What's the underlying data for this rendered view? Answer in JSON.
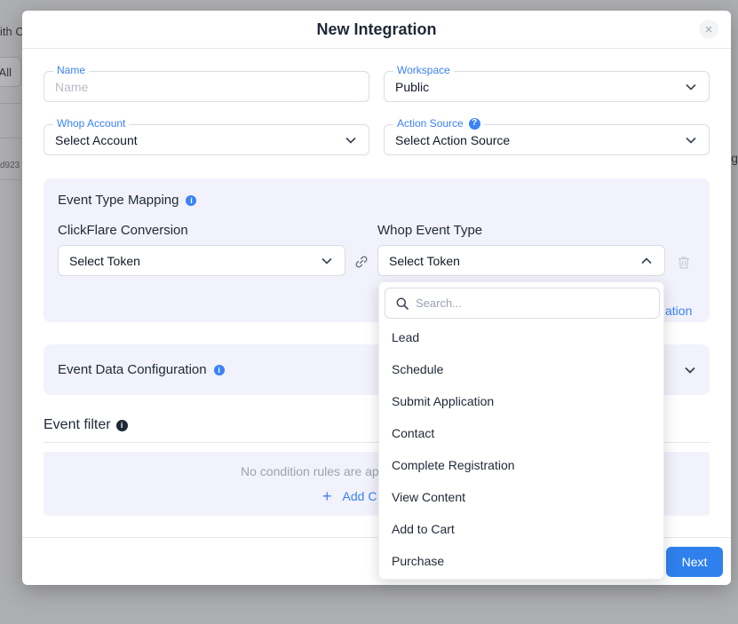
{
  "background": {
    "left_partial_text": "ith C",
    "all_button": "All",
    "partial_id": "d923",
    "right_partial_text": "g"
  },
  "modal": {
    "title": "New Integration",
    "close_glyph": "×"
  },
  "form": {
    "name": {
      "label": "Name",
      "placeholder": "Name",
      "value": ""
    },
    "workspace": {
      "label": "Workspace",
      "value": "Public"
    },
    "whop_account": {
      "label": "Whop Account",
      "value": "Select Account"
    },
    "action_source": {
      "label": "Action Source",
      "value": "Select Action Source"
    }
  },
  "event_mapping": {
    "title": "Event Type Mapping",
    "col_left": "ClickFlare Conversion",
    "col_right": "Whop Event Type",
    "left_select": "Select Token",
    "right_select": "Select Token",
    "partial_link": "ation"
  },
  "event_data": {
    "title": "Event Data Configuration"
  },
  "event_filter": {
    "title": "Event filter",
    "empty_text": "No condition rules are ap",
    "add_label": "Add C"
  },
  "footer": {
    "next_label": "Next"
  },
  "dropdown": {
    "search_placeholder": "Search...",
    "options": [
      "Lead",
      "Schedule",
      "Submit Application",
      "Contact",
      "Complete Registration",
      "View Content",
      "Add to Cart",
      "Purchase"
    ]
  },
  "colors": {
    "accent": "#3b82f6",
    "primary_button": "#2f80ed",
    "panel_bg": "#f1f2fb"
  },
  "icons": [
    "chevron-down-icon",
    "chevron-up-icon",
    "info-icon",
    "help-icon",
    "link-icon",
    "trash-icon",
    "search-icon",
    "plus-icon",
    "close-icon"
  ]
}
